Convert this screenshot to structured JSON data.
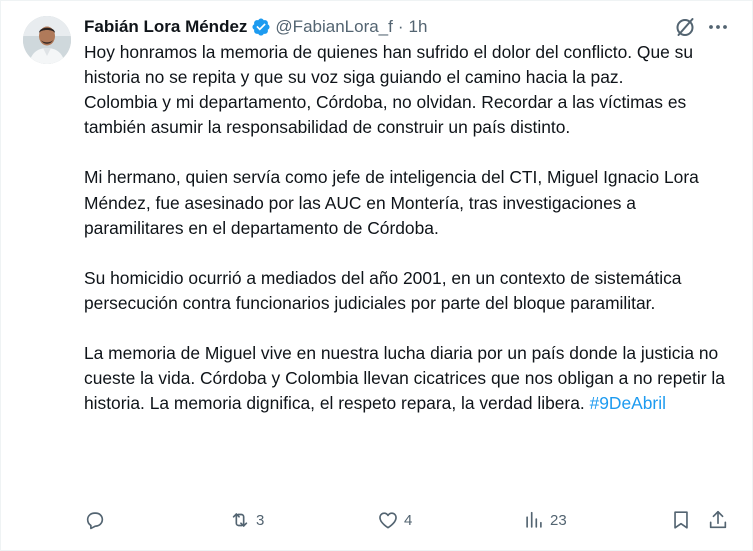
{
  "author": {
    "display_name": "Fabián Lora Méndez",
    "handle": "@FabianLora_f",
    "separator": "·",
    "time": "1h"
  },
  "tweet": {
    "lines": [
      "Hoy honramos la memoria de quienes han sufrido el dolor del conflicto. Que su historia no se repita y que su voz siga guiando el camino hacia la paz.",
      "Colombia y mi departamento, Córdoba, no olvidan. Recordar a las víctimas es también asumir la responsabilidad de construir un país distinto."
    ],
    "paragraph2": "Mi hermano, quien servía como jefe de inteligencia del CTI, Miguel Ignacio Lora Méndez, fue asesinado por las AUC en Montería, tras investigaciones a paramilitares en el departamento de Córdoba.",
    "paragraph3": "Su homicidio ocurrió a mediados del año 2001, en un contexto de sistemática persecución contra funcionarios judiciales por parte del bloque paramilitar.",
    "paragraph4": "La memoria de Miguel vive en nuestra lucha diaria por un país donde la justicia no cueste la vida. Córdoba y Colombia llevan cicatrices que nos obligan a no repetir la historia. La memoria dignifica, el respeto repara, la verdad libera.",
    "hashtag": "#9DeAbril"
  },
  "actions": {
    "reply_count": "",
    "repost_count": "3",
    "like_count": "4",
    "views_count": "23"
  },
  "colors": {
    "text": "#0f1419",
    "secondary": "#536471",
    "link": "#1d9bf0",
    "verified": "#1d9bf0"
  },
  "icons": {
    "verified": "verified-badge-icon",
    "grok": "grok-icon",
    "more": "more-icon",
    "reply": "reply-icon",
    "repost": "repost-icon",
    "like": "like-icon",
    "views": "views-icon",
    "bookmark": "bookmark-icon",
    "share": "share-icon"
  }
}
